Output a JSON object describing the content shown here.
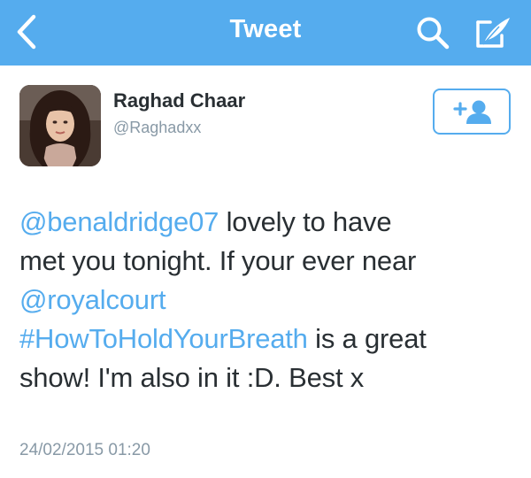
{
  "navbar": {
    "title": "Tweet",
    "back_icon": "chevron-left-icon",
    "search_icon": "search-icon",
    "compose_icon": "compose-icon",
    "background": "#55acee"
  },
  "author": {
    "name": "Raghad Chaar",
    "handle": "@Raghadxx",
    "avatar_icon": "profile-photo"
  },
  "follow_button": {
    "icon": "follow-user-icon",
    "accent": "#55acee"
  },
  "tweet": {
    "segments": [
      {
        "text": "@benaldridge07",
        "type": "mention"
      },
      {
        "text": " lovely to have",
        "type": "text"
      },
      {
        "text": "met you tonight. If your ever near",
        "type": "text"
      },
      {
        "text": "@royalcourt",
        "type": "mention"
      },
      {
        "text": "#HowToHoldYourBreath",
        "type": "hashtag"
      },
      {
        "text": " is a great",
        "type": "text"
      },
      {
        "text": "show! I'm also in it :D. Best x",
        "type": "text"
      }
    ],
    "timestamp": "24/02/2015 01:20"
  },
  "colors": {
    "link": "#55acee",
    "text": "#292f33",
    "muted": "#8899a6"
  }
}
